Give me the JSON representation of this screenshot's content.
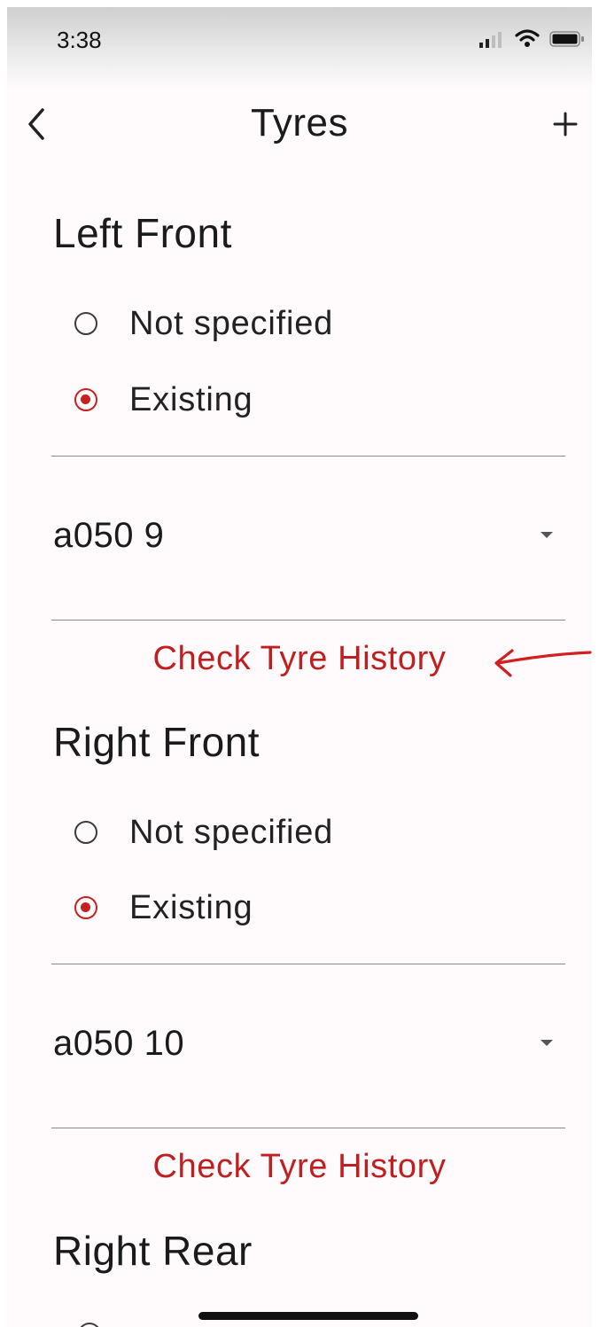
{
  "status_bar": {
    "time": "3:38"
  },
  "app_bar": {
    "title": "Tyres"
  },
  "sections": [
    {
      "title": "Left Front",
      "options": [
        "Not specified",
        "Existing"
      ],
      "selected": "Existing",
      "tyre_value": "a050 9",
      "history_link": "Check Tyre History"
    },
    {
      "title": "Right Front",
      "options": [
        "Not specified",
        "Existing"
      ],
      "selected": "Existing",
      "tyre_value": "a050 10",
      "history_link": "Check Tyre History"
    },
    {
      "title": "Right Rear"
    }
  ],
  "colors": {
    "accent": "#c62020",
    "link": "#c01f1f",
    "text": "#1b1b1b",
    "background": "#fffbfd"
  },
  "icons": {
    "back": "chevron-left-icon",
    "add": "plus-icon",
    "dropdown": "caret-down-icon",
    "signal": "signal-icon",
    "wifi": "wifi-icon",
    "battery": "battery-icon"
  }
}
